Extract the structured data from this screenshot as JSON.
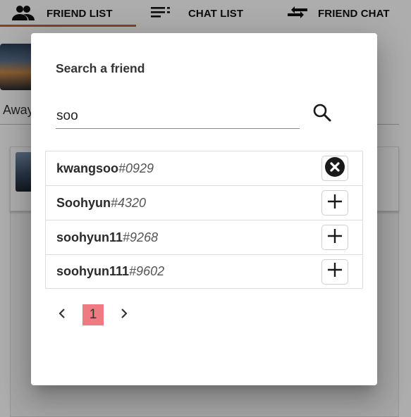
{
  "tabs": [
    {
      "label": "FRIEND LIST",
      "icon": "people-icon",
      "active": true
    },
    {
      "label": "CHAT LIST",
      "icon": "list-icon",
      "active": false
    },
    {
      "label": "FRIEND CHAT",
      "icon": "swap-arrows-icon",
      "active": false
    }
  ],
  "background": {
    "status_text": "Away"
  },
  "dialog": {
    "title": "Search a friend",
    "search_value": "soo",
    "search_icon": "search-icon",
    "results": [
      {
        "name": "kwangsoo",
        "tag": "#0929",
        "action": "remove",
        "action_icon": "close-circle-icon"
      },
      {
        "name": "Soohyun",
        "tag": "#4320",
        "action": "add",
        "action_icon": "plus-icon"
      },
      {
        "name": "soohyun11",
        "tag": "#9268",
        "action": "add",
        "action_icon": "plus-icon"
      },
      {
        "name": "soohyun111",
        "tag": "#9602",
        "action": "add",
        "action_icon": "plus-icon"
      }
    ],
    "pagination": {
      "current_page": "1"
    }
  },
  "colors": {
    "tab_indicator": "#c0652b",
    "page_highlight": "#f07a82",
    "scrim": "rgba(0,0,0,0.32)"
  }
}
